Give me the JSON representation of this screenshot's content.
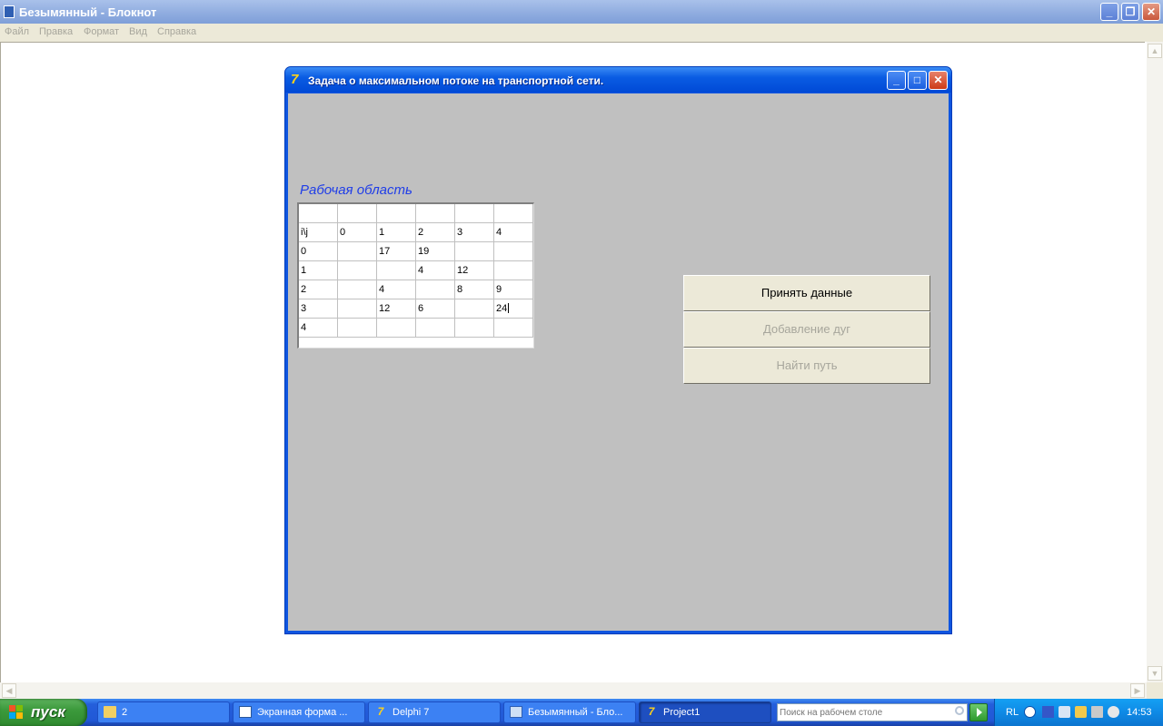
{
  "notepad": {
    "title": "Безымянный - Блокнот",
    "controls": {
      "minimize": "_",
      "maximize": "❐",
      "close": "✕"
    },
    "menu": [
      "Файл",
      "Правка",
      "Формат",
      "Вид",
      "Справка"
    ],
    "scroll_up": "▲",
    "scroll_down": "▼",
    "scroll_left": "◀",
    "scroll_right": "▶"
  },
  "form": {
    "title": "Задача о максимальном потоке на транспортной сети.",
    "icon_glyph": "7",
    "controls": {
      "minimize": "_",
      "maximize": "□",
      "close": "✕"
    },
    "work_area_label": "Рабочая область",
    "grid": [
      [
        "",
        "",
        "",
        "",
        "",
        ""
      ],
      [
        "i\\j",
        "0",
        "1",
        "2",
        "3",
        "4"
      ],
      [
        "0",
        "",
        "17",
        "19",
        "",
        ""
      ],
      [
        "1",
        "",
        "",
        "4",
        "12",
        ""
      ],
      [
        "2",
        "",
        "4",
        "",
        "8",
        "9"
      ],
      [
        "3",
        "",
        "12",
        "6",
        "",
        "24"
      ],
      [
        "4",
        "",
        "",
        "",
        "",
        ""
      ]
    ],
    "buttons": {
      "accept": "Принять данные",
      "add_arcs": "Добавление дуг",
      "find_path": "Найти путь"
    }
  },
  "taskbar": {
    "start_label": "пуск",
    "tasks": [
      {
        "label": "2",
        "icon": "folder-icon"
      },
      {
        "label": "Экранная форма ...",
        "icon": "word-icon"
      },
      {
        "label": "Delphi 7",
        "icon": "delphi-icon"
      },
      {
        "label": "Безымянный - Бло...",
        "icon": "notepad-icon"
      },
      {
        "label": "Project1",
        "icon": "delphi-icon",
        "active": true
      }
    ],
    "search_placeholder": "Поиск на рабочем столе",
    "language": "RL",
    "clock": "14:53"
  }
}
